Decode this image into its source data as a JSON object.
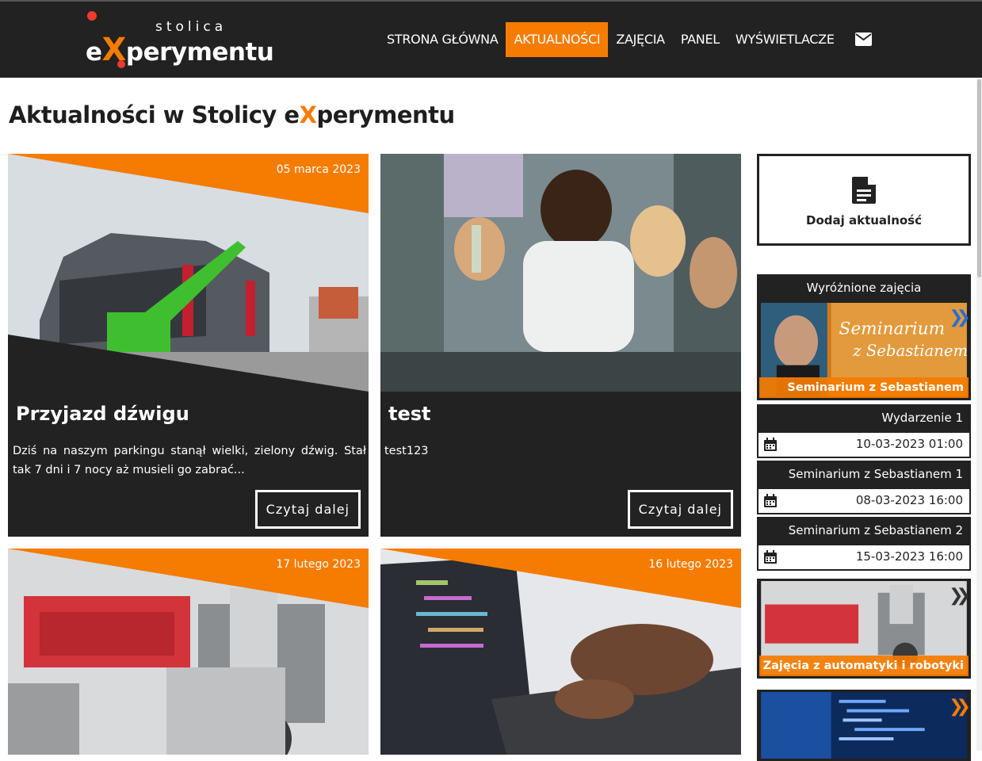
{
  "header": {
    "logo_top": "stolica",
    "logo_e": "e",
    "logo_x": "X",
    "logo_rest": "perymentu",
    "nav": [
      {
        "label": "STRONA GŁÓWNA",
        "active": false
      },
      {
        "label": "AKTUALNOŚCI",
        "active": true
      },
      {
        "label": "ZAJĘCIA",
        "active": false
      },
      {
        "label": "PANEL",
        "active": false
      },
      {
        "label": "WYŚWIETLACZE",
        "active": false
      }
    ],
    "mail_icon": "mail-icon"
  },
  "page": {
    "title_pre": "Aktualności w Stolicy e",
    "title_x": "X",
    "title_post": "perymentu"
  },
  "news": [
    {
      "date": "05 marca 2023",
      "title": "Przyjazd dźwigu",
      "excerpt": "Dziś na naszym parkingu stanął wielki, zielony dźwig. Stał tak 7 dni i 7 nocy aż musieli go zabrać...",
      "more": "Czytaj dalej"
    },
    {
      "date": "",
      "title": "test",
      "excerpt": "test123",
      "more": "Czytaj dalej"
    },
    {
      "date": "17 lutego 2023",
      "title": "",
      "excerpt": "",
      "more": ""
    },
    {
      "date": "16 lutego 2023",
      "title": "",
      "excerpt": "",
      "more": ""
    }
  ],
  "sidebar": {
    "add_label": "Dodaj aktualność",
    "add_icon": "document-icon",
    "featured_heading": "Wyróżnione zajęcia",
    "featured": [
      {
        "caption": "Seminarium z Sebastianem",
        "overlay_text_1": "Seminarium",
        "overlay_text_2": "z Sebastianem"
      },
      {
        "caption": "Zajęcia z automatyki i robotyki"
      },
      {
        "caption": ""
      }
    ],
    "events": [
      {
        "name": "Wydarzenie 1",
        "datetime": "10-03-2023 01:00"
      },
      {
        "name": "Seminarium z Sebastianem 1",
        "datetime": "08-03-2023 16:00"
      },
      {
        "name": "Seminarium z Sebastianem 2",
        "datetime": "15-03-2023 16:00"
      }
    ]
  },
  "colors": {
    "accent": "#f57c00",
    "dark": "#222222",
    "logo_dot": "#ee3b2b"
  }
}
